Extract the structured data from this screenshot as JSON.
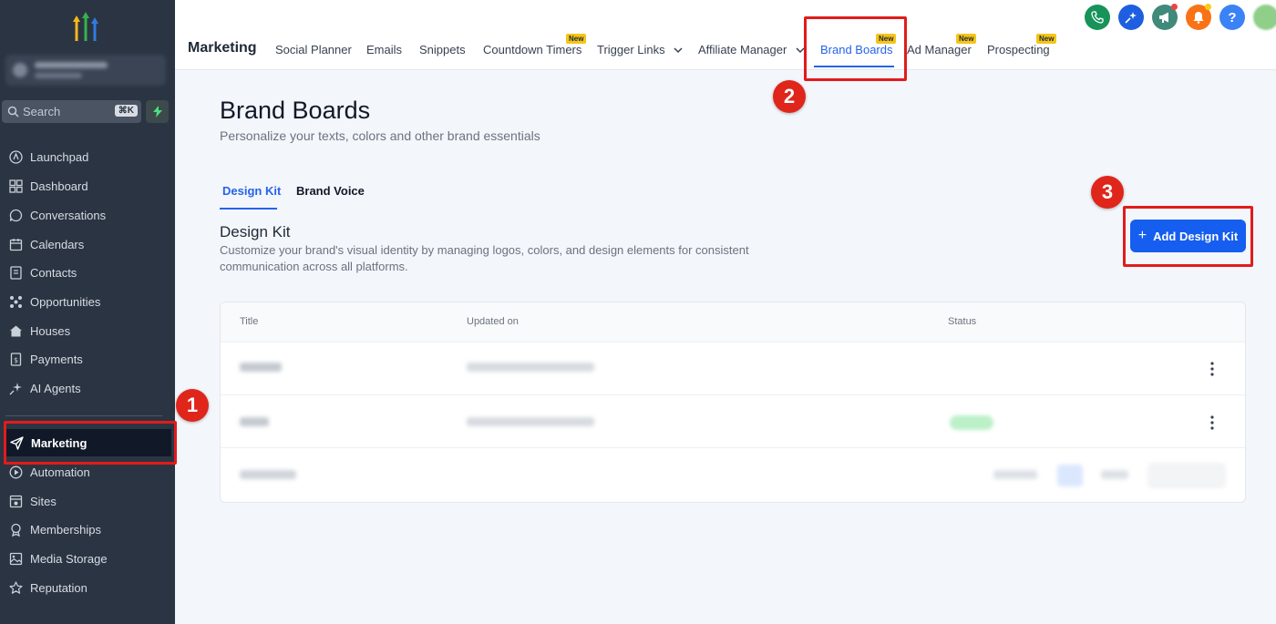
{
  "sidebar": {
    "search_placeholder": "Search",
    "search_shortcut": "⌘K",
    "items": [
      {
        "label": "Launchpad",
        "icon": "launchpad-icon"
      },
      {
        "label": "Dashboard",
        "icon": "dashboard-icon"
      },
      {
        "label": "Conversations",
        "icon": "chat-icon"
      },
      {
        "label": "Calendars",
        "icon": "calendar-icon"
      },
      {
        "label": "Contacts",
        "icon": "contacts-icon"
      },
      {
        "label": "Opportunities",
        "icon": "opportunities-icon"
      },
      {
        "label": "Houses",
        "icon": "house-icon"
      },
      {
        "label": "Payments",
        "icon": "payments-icon"
      },
      {
        "label": "AI Agents",
        "icon": "sparkle-icon"
      },
      {
        "label": "Marketing",
        "icon": "send-icon"
      },
      {
        "label": "Automation",
        "icon": "automation-icon"
      },
      {
        "label": "Sites",
        "icon": "sites-icon"
      },
      {
        "label": "Memberships",
        "icon": "membership-icon"
      },
      {
        "label": "Media Storage",
        "icon": "media-icon"
      },
      {
        "label": "Reputation",
        "icon": "star-icon"
      }
    ]
  },
  "topbar": {
    "title": "Marketing",
    "tabs": [
      {
        "label": "Social Planner"
      },
      {
        "label": "Emails"
      },
      {
        "label": "Snippets"
      },
      {
        "label": "Countdown Timers",
        "badge": "New"
      },
      {
        "label": "Trigger Links"
      },
      {
        "label": "Affiliate Manager"
      },
      {
        "label": "Brand Boards",
        "badge": "New"
      },
      {
        "label": "Ad Manager",
        "badge": "New"
      },
      {
        "label": "Prospecting",
        "badge": "New"
      }
    ],
    "icons": [
      "phone-icon",
      "magic-icon",
      "megaphone-icon",
      "bell-icon",
      "help-icon",
      "avatar"
    ],
    "help_glyph": "?"
  },
  "main": {
    "title": "Brand Boards",
    "subtitle": "Personalize your texts, colors and other brand essentials",
    "content_tabs": [
      {
        "label": "Design Kit"
      },
      {
        "label": "Brand Voice"
      }
    ],
    "section_title": "Design Kit",
    "section_desc": "Customize your brand's visual identity by managing logos, colors, and design elements for consistent communication across all platforms.",
    "add_button": "Add Design Kit",
    "add_button_glyph": "+"
  },
  "table": {
    "headers": [
      "Title",
      "Updated on",
      "Status"
    ]
  },
  "annotations": [
    "1",
    "2",
    "3"
  ],
  "colors": {
    "sidebar_bg": "#2b3442",
    "accent": "#155eef",
    "annotation": "#e21b1b",
    "badge": "#f5c518"
  }
}
